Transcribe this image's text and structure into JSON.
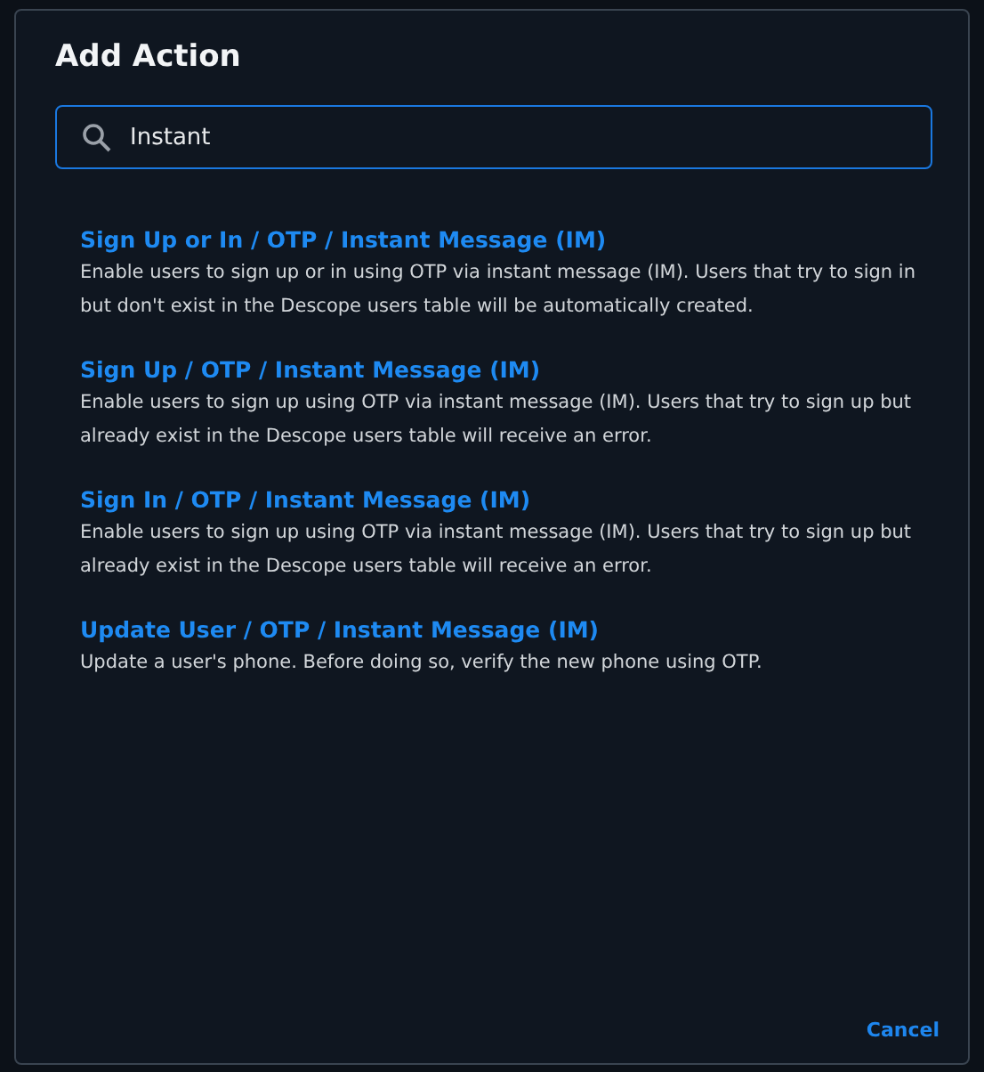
{
  "dialog": {
    "title": "Add Action",
    "search": {
      "value": "Instant"
    },
    "actions": [
      {
        "title": "Sign Up or In / OTP / Instant Message (IM)",
        "description": "Enable users to sign up or in using OTP via instant message (IM). Users that try to sign in but don't exist in the Descope users table will be automatically created."
      },
      {
        "title": "Sign Up / OTP / Instant Message (IM)",
        "description": "Enable users to sign up using OTP via instant message (IM). Users that try to sign up but already exist in the Descope users table will receive an error."
      },
      {
        "title": "Sign In / OTP / Instant Message (IM)",
        "description": "Enable users to sign up using OTP via instant message (IM). Users that try to sign up but already exist in the Descope users table will receive an error."
      },
      {
        "title": "Update User / OTP / Instant Message (IM)",
        "description": "Update a user's phone. Before doing so, verify the new phone using OTP."
      }
    ],
    "buttons": [
      "Cancel"
    ]
  }
}
